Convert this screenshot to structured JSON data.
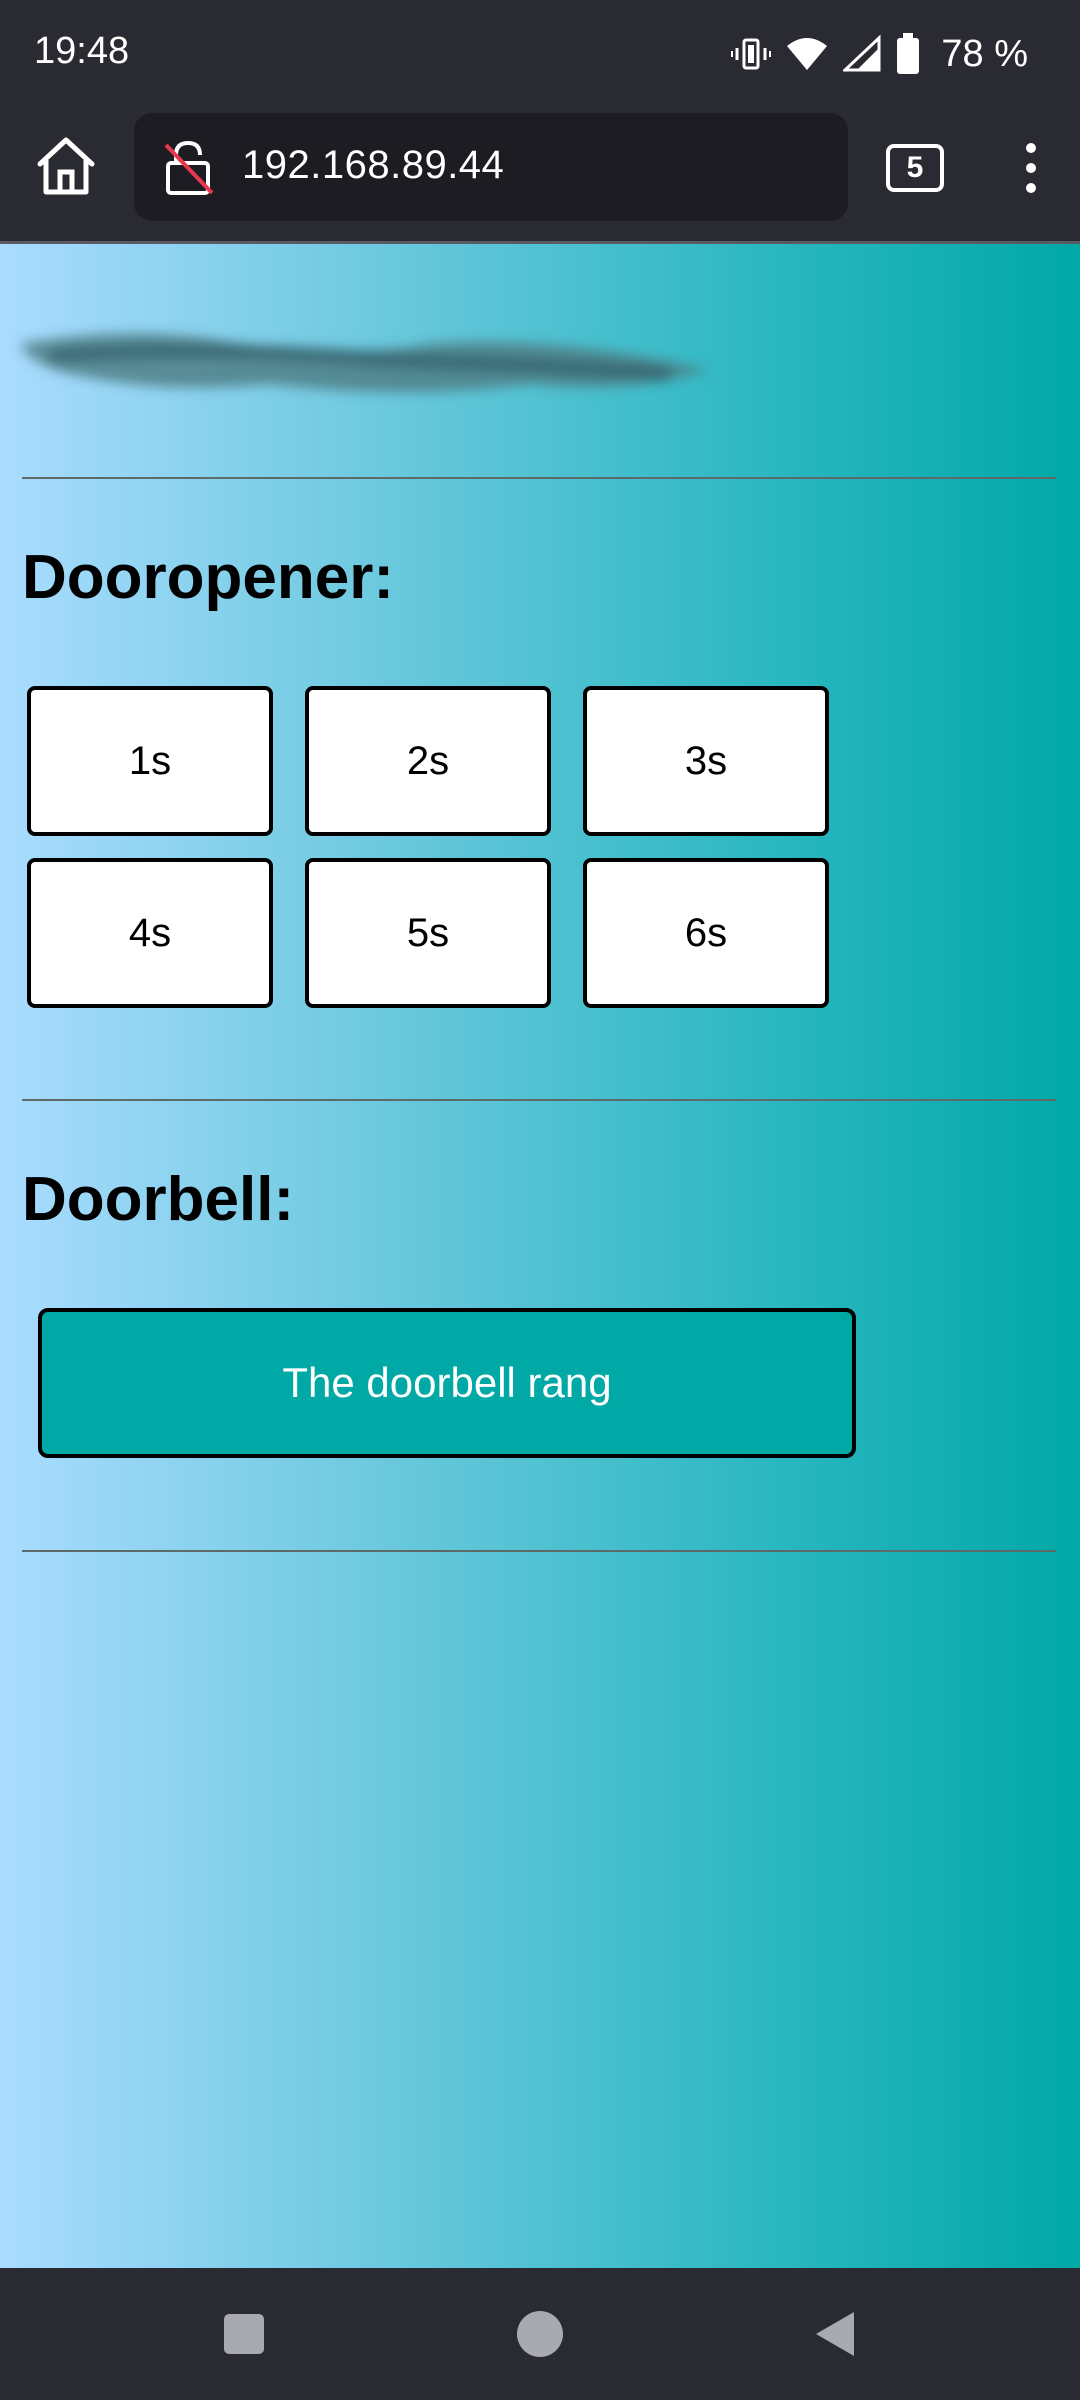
{
  "status_bar": {
    "time": "19:48",
    "battery_percent": "78 %",
    "icons": [
      "vibrate-icon",
      "wifi-icon",
      "signal-icon",
      "battery-icon"
    ]
  },
  "browser": {
    "url": "192.168.89.44",
    "tab_count": "5",
    "icons": [
      "home-icon",
      "insecure-lock-icon",
      "overflow-menu-icon"
    ]
  },
  "page": {
    "dooropener": {
      "title": "Dooropener:",
      "buttons": [
        "1s",
        "2s",
        "3s",
        "4s",
        "5s",
        "6s"
      ]
    },
    "doorbell": {
      "title": "Doorbell:",
      "status_button": "The doorbell rang"
    }
  },
  "colors": {
    "accent": "#00a8a6",
    "gradient_start": "#aadcff",
    "gradient_end": "#00a8a6",
    "chrome": "#2a2a33"
  },
  "nav_bar": {
    "icons": [
      "recents-icon",
      "home-circle-icon",
      "back-icon"
    ]
  }
}
